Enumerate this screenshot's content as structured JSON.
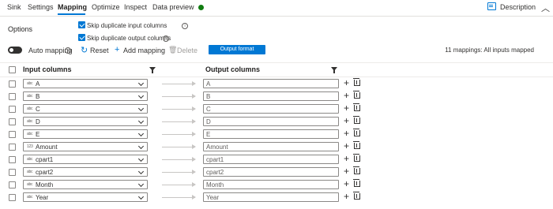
{
  "tabs": [
    {
      "label": "Sink"
    },
    {
      "label": "Settings"
    },
    {
      "label": "Mapping",
      "active": true
    },
    {
      "label": "Optimize"
    },
    {
      "label": "Inspect"
    },
    {
      "label": "Data preview",
      "status_color": "#107c10"
    }
  ],
  "header_right": {
    "description_label": "Description",
    "description_icon": "description-icon",
    "collapse_icon": "chevron-up-icon"
  },
  "options": {
    "label": "Options",
    "skip_input": {
      "label": "Skip duplicate input columns",
      "checked": true
    },
    "skip_output": {
      "label": "Skip duplicate output columns",
      "checked": true
    }
  },
  "toolbar": {
    "auto_mapping_label": "Auto mapping",
    "auto_mapping_on": false,
    "reset_label": "Reset",
    "add_label": "Add mapping",
    "delete_label": "Delete",
    "output_format_label": "Output format",
    "summary": "11 mappings: All inputs mapped"
  },
  "columns": {
    "input": "Input columns",
    "output": "Output columns"
  },
  "mappings": [
    {
      "type": "abc",
      "input": "A",
      "output": "A"
    },
    {
      "type": "abc",
      "input": "B",
      "output": "B"
    },
    {
      "type": "abc",
      "input": "C",
      "output": "C"
    },
    {
      "type": "abc",
      "input": "D",
      "output": "D"
    },
    {
      "type": "abc",
      "input": "E",
      "output": "E"
    },
    {
      "type": "123",
      "input": "Amount",
      "output": "Amount"
    },
    {
      "type": "abc",
      "input": "cpart1",
      "output": "cpart1"
    },
    {
      "type": "abc",
      "input": "cpart2",
      "output": "cpart2"
    },
    {
      "type": "abc",
      "input": "Month",
      "output": "Month"
    },
    {
      "type": "abc",
      "input": "Year",
      "output": "Year"
    }
  ],
  "colors": {
    "accent": "#0078d4",
    "status_ok": "#107c10"
  }
}
